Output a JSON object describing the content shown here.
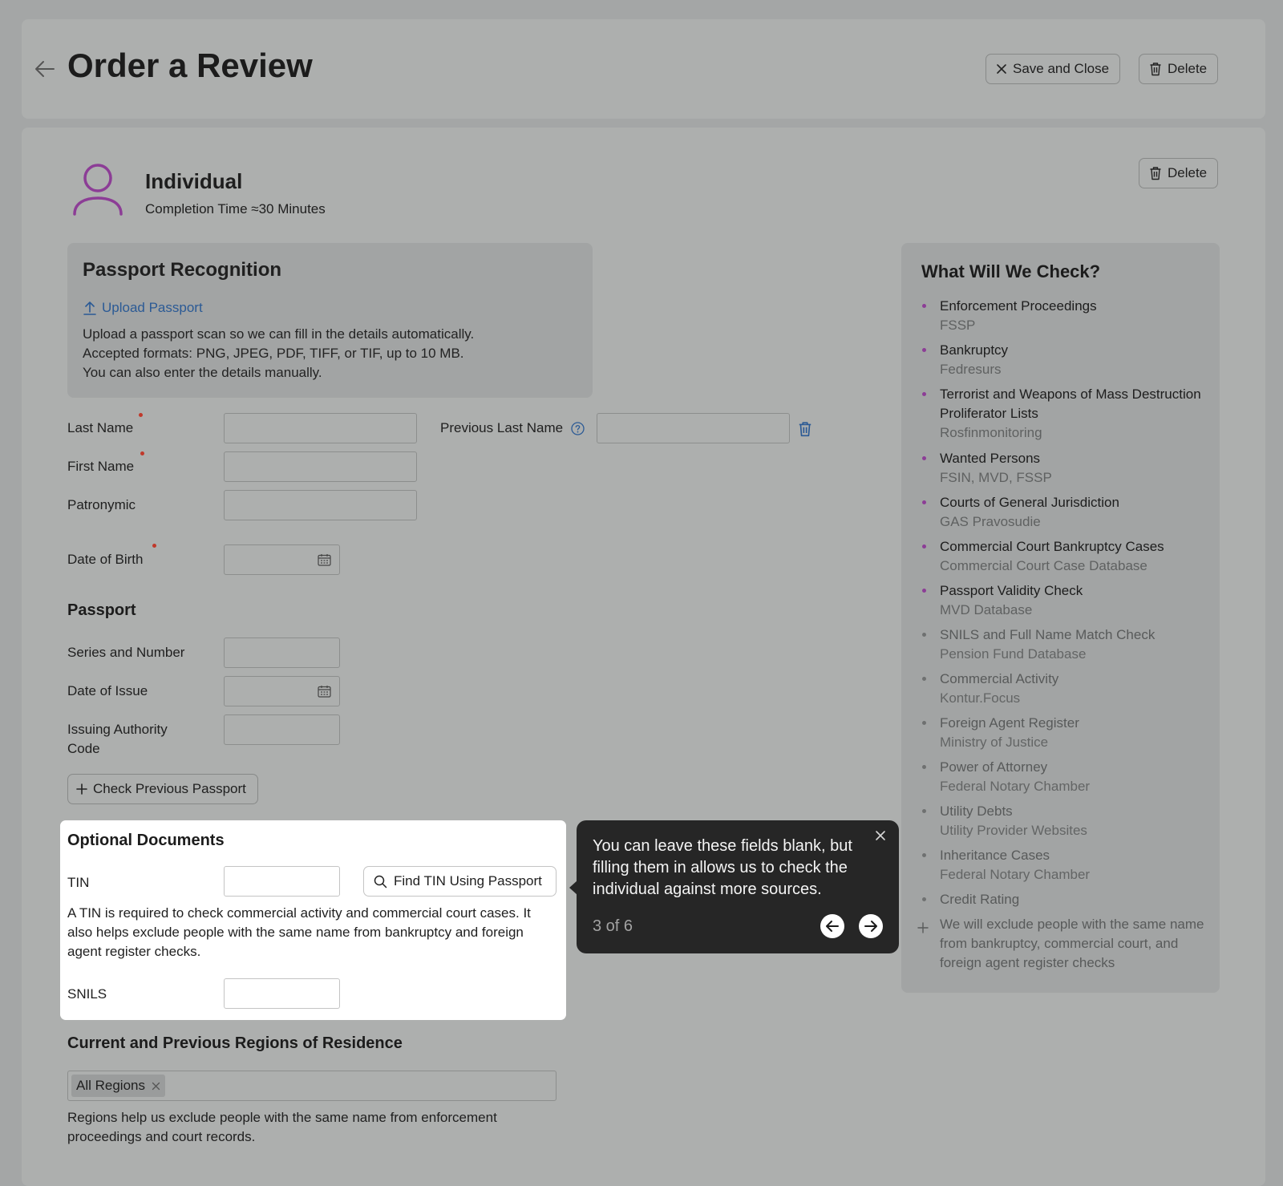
{
  "header": {
    "title": "Order a Review",
    "save_close_label": "Save and Close",
    "delete_label": "Delete"
  },
  "individual": {
    "title": "Individual",
    "completion": "Completion Time ≈30 Minutes",
    "delete_label": "Delete",
    "icon": "person-icon",
    "icon_color": "#8c3d96"
  },
  "passport_recognition": {
    "title": "Passport Recognition",
    "upload_label": "Upload Passport",
    "desc_lines": [
      "Upload a passport scan so we can fill in the details automatically.",
      "Accepted formats: PNG, JPEG, PDF, TIFF, or TIF, up to 10 MB.",
      "You can also enter the details manually."
    ]
  },
  "form": {
    "last_name_label": "Last Name",
    "previous_last_name_label": "Previous Last Name",
    "first_name_label": "First Name",
    "patronymic_label": "Patronymic",
    "dob_label": "Date of Birth",
    "last_name_value": "",
    "previous_last_name_value": "",
    "first_name_value": "",
    "patronymic_value": ""
  },
  "passport": {
    "title": "Passport",
    "series_label": "Series and Number",
    "issue_date_label": "Date of Issue",
    "authority_label_line1": "Issuing Authority",
    "authority_label_line2": "Code",
    "check_previous_label": "Check Previous Passport"
  },
  "optional_documents": {
    "title": "Optional Documents",
    "tin_label": "TIN",
    "find_tin_label": "Find TIN Using Passport",
    "tin_desc": "A TIN is required to check commercial activity and commercial court cases. It also helps exclude people with the same name from bankruptcy and foreign agent register checks.",
    "snils_label": "SNILS"
  },
  "tooltip": {
    "text": "You can leave these fields blank, but filling them in allows us to check the individual against more sources.",
    "step": "3 of 6"
  },
  "regions": {
    "title": "Current and Previous Regions of Residence",
    "tag": "All Regions",
    "desc": "Regions help us exclude people with the same name from enforcement proceedings and court records."
  },
  "checks": {
    "title": "What Will We Check?",
    "items": [
      {
        "name": "Enforcement Proceedings",
        "source": "FSSP",
        "active": true
      },
      {
        "name": "Bankruptcy",
        "source": "Fedresurs",
        "active": true
      },
      {
        "name": "Terrorist and Weapons of Mass Destruction Proliferator Lists",
        "source": "Rosfinmonitoring",
        "active": true
      },
      {
        "name": "Wanted Persons",
        "source": "FSIN, MVD, FSSP",
        "active": true
      },
      {
        "name": "Courts of General Jurisdiction",
        "source": "GAS Pravosudie",
        "active": true
      },
      {
        "name": "Commercial Court Bankruptcy Cases",
        "source": "Commercial Court Case Database",
        "active": true
      },
      {
        "name": "Passport Validity Check",
        "source": "MVD Database",
        "active": true
      },
      {
        "name": "SNILS and Full Name Match Check",
        "source": "Pension Fund Database",
        "active": false
      },
      {
        "name": "Commercial Activity",
        "source": "Kontur.Focus",
        "active": false
      },
      {
        "name": "Foreign Agent Register",
        "source": "Ministry of Justice",
        "active": false
      },
      {
        "name": "Power of Attorney",
        "source": "Federal Notary Chamber",
        "active": false
      },
      {
        "name": "Utility Debts",
        "source": "Utility Provider Websites",
        "active": false
      },
      {
        "name": "Inheritance Cases",
        "source": "Federal Notary Chamber",
        "active": false
      },
      {
        "name": "Credit Rating",
        "source": "",
        "active": false
      }
    ],
    "plus_note": "We will exclude people with the same name from bankruptcy, commercial court, and foreign agent register checks"
  }
}
